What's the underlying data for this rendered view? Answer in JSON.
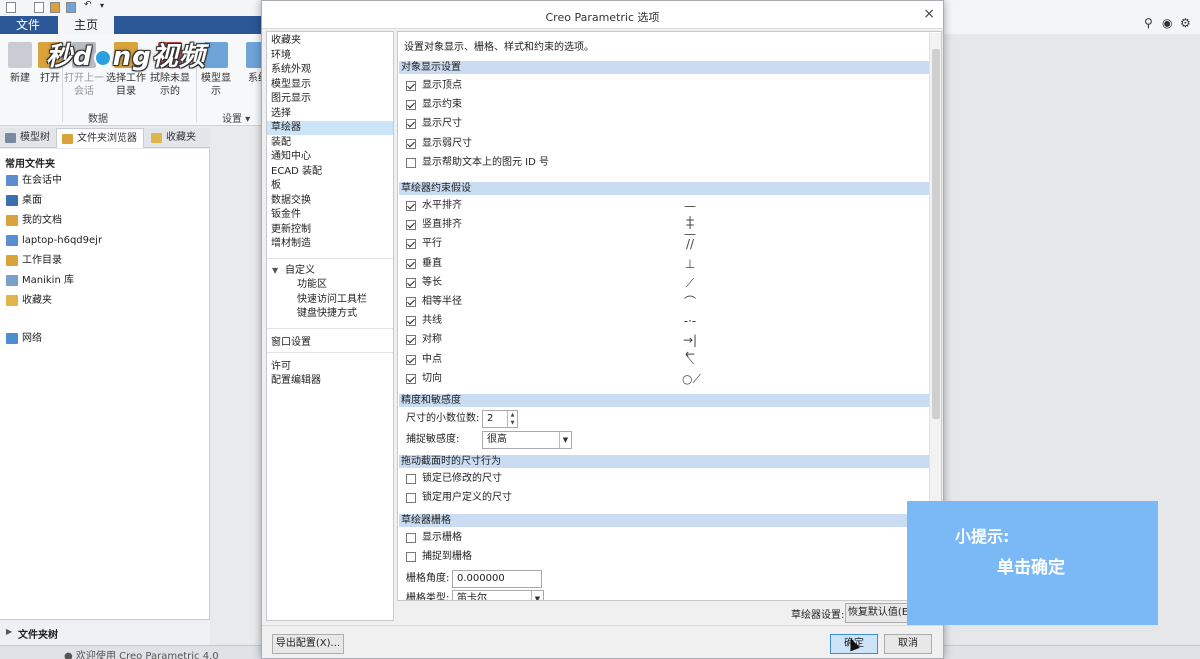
{
  "app": {
    "ribbon_tabs": [
      "文件",
      "主页"
    ],
    "ribbon_buttons": [
      {
        "label": "新建",
        "dim": false
      },
      {
        "label": "打开",
        "dim": false
      },
      {
        "label": "打开上一\n会话",
        "dim": true
      },
      {
        "label": "选择工作\n目录",
        "dim": false
      },
      {
        "label": "拭除未显\n示的",
        "dim": false
      },
      {
        "label": "模型显示",
        "dim": false
      },
      {
        "label": "系统",
        "dim": false
      }
    ],
    "group_labels": {
      "data": "数据",
      "settings": "设置 ▾"
    },
    "logo": {
      "pre": "秒",
      "mid": "d",
      "post": "ng视频",
      "o": "o"
    },
    "nav_tabs": [
      "模型树",
      "文件夹浏览器",
      "收藏夹"
    ],
    "nav_title": "常用文件夹",
    "nav_items": [
      "在会话中",
      "桌面",
      "我的文档",
      "laptop-h6qd9ejr",
      "工作目录",
      "Manikin 库",
      "收藏夹",
      "网络"
    ],
    "nav_footer": "文件夹树",
    "status_text": "● 欢迎使用 Creo Parametric 4.0"
  },
  "dialog": {
    "title": "Creo Parametric 选项",
    "close_glyph": "×",
    "description": "设置对象显示、栅格、样式和约束的选项。",
    "nav_items": [
      "收藏夹",
      "环境",
      "系统外观",
      "模型显示",
      "图元显示",
      "选择",
      "草绘器",
      "装配",
      "通知中心",
      "ECAD 装配",
      "板",
      "数据交换",
      "钣金件",
      "更新控制",
      "增材制造"
    ],
    "nav_selected": "草绘器",
    "customize": {
      "label": "自定义",
      "children": [
        "功能区",
        "快速访问工具栏",
        "键盘快捷方式"
      ]
    },
    "nav_window": "窗口设置",
    "nav_license": "许可",
    "nav_config": "配置编辑器",
    "sections": {
      "object_display": {
        "title": "对象显示设置",
        "items": [
          {
            "label": "显示顶点",
            "checked": true
          },
          {
            "label": "显示约束",
            "checked": true
          },
          {
            "label": "显示尺寸",
            "checked": true
          },
          {
            "label": "显示弱尺寸",
            "checked": true
          },
          {
            "label": "显示帮助文本上的图元 ID 号",
            "checked": false
          }
        ]
      },
      "constraints": {
        "title": "草绘器约束假设",
        "items": [
          {
            "label": "水平排齐",
            "checked": true,
            "symbol": "—+—"
          },
          {
            "label": "竖直排齐",
            "checked": true,
            "symbol": "+"
          },
          {
            "label": "平行",
            "checked": true,
            "symbol": "//"
          },
          {
            "label": "垂直",
            "checked": true,
            "symbol": "⊥"
          },
          {
            "label": "等长",
            "checked": true,
            "symbol": "⟋"
          },
          {
            "label": "相等半径",
            "checked": true,
            "symbol": "⌒"
          },
          {
            "label": "共线",
            "checked": true,
            "symbol": "-·-"
          },
          {
            "label": "对称",
            "checked": true,
            "symbol": "→|←"
          },
          {
            "label": "中点",
            "checked": true,
            "symbol": "⟍"
          },
          {
            "label": "切向",
            "checked": true,
            "symbol": "○⟋"
          }
        ]
      },
      "precision": {
        "title": "精度和敏感度",
        "decimals_label": "尺寸的小数位数:",
        "decimals_value": "2",
        "snap_label": "捕捉敏感度:",
        "snap_value": "很高"
      },
      "drag": {
        "title": "拖动截面时的尺寸行为",
        "items": [
          {
            "label": "锁定已修改的尺寸",
            "checked": false
          },
          {
            "label": "锁定用户定义的尺寸",
            "checked": false
          }
        ]
      },
      "grid": {
        "title": "草绘器栅格",
        "items": [
          {
            "label": "显示栅格",
            "checked": false
          },
          {
            "label": "捕捉到栅格",
            "checked": false
          }
        ],
        "angle_label": "栅格角度:",
        "angle_value": "0.000000",
        "type_label": "栅格类型:",
        "type_value": "笛卡尔"
      }
    },
    "sketcher_settings_label": "草绘器设置:",
    "restore_defaults": "恢复默认值(E)",
    "export_config": "导出配置(X)...",
    "ok": "确定",
    "cancel": "取消"
  },
  "tip": {
    "title": "小提示:",
    "body": "单击确定"
  },
  "colors": {
    "accent": "#2b5797",
    "section_header": "#c9dcf2",
    "selection": "#cce4f7",
    "tip_bg": "#7ab9f6"
  }
}
